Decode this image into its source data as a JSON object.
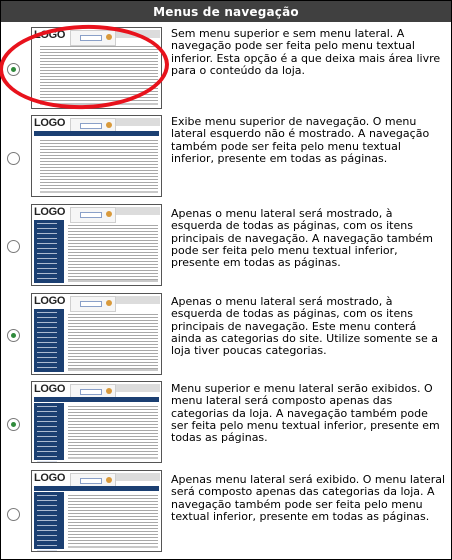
{
  "header": {
    "title": "Menus de navegação"
  },
  "options": [
    {
      "id": "none",
      "checked": true,
      "nav": false,
      "side": false,
      "text": "Sem menu superior e sem menu lateral. A navegação pode ser feita pelo menu textual inferior. Esta opção é a que deixa mais área livre para o conteúdo da loja."
    },
    {
      "id": "top",
      "checked": false,
      "nav": true,
      "side": false,
      "text": "Exibe menu superior de navegação. O menu lateral esquerdo não é mostrado. A navegação também pode ser feita pelo menu textual inferior, presente em todas as páginas."
    },
    {
      "id": "side-main",
      "checked": false,
      "nav": false,
      "side": true,
      "text": "Apenas o menu lateral será mostrado, à esquerda de todas as páginas, com os itens principais de navegação. A navegação também pode ser feita pelo menu textual inferior, presente em todas as páginas."
    },
    {
      "id": "side-categories",
      "checked": true,
      "nav": false,
      "side": true,
      "text": "Apenas o menu lateral será mostrado, à esquerda de todas as páginas, com os itens principais de navegação. Este menu conterá ainda as categorias do site. Utilize somente se a loja tiver poucas categorias."
    },
    {
      "id": "top-side",
      "checked": true,
      "nav": true,
      "side": true,
      "text": "Menu superior e menu lateral serão exibidos. O menu lateral será composto apenas das categorias da loja. A navegação também pode ser feita pelo menu textual inferior, presente em todas as páginas."
    },
    {
      "id": "side-only-categories",
      "checked": false,
      "nav": true,
      "side": true,
      "text": "Apenas menu lateral será exibido. O menu lateral será composto apenas das categorias da loja. A navegação também pode ser feita pelo menu textual inferior, presente em todas as páginas."
    }
  ],
  "thumb": {
    "logo": "LOGO"
  },
  "colors": {
    "header_bg": "#404040",
    "nav_blue": "#1b3f72",
    "highlight": "#e8121c",
    "radio_dot": "#2f8a3b"
  }
}
